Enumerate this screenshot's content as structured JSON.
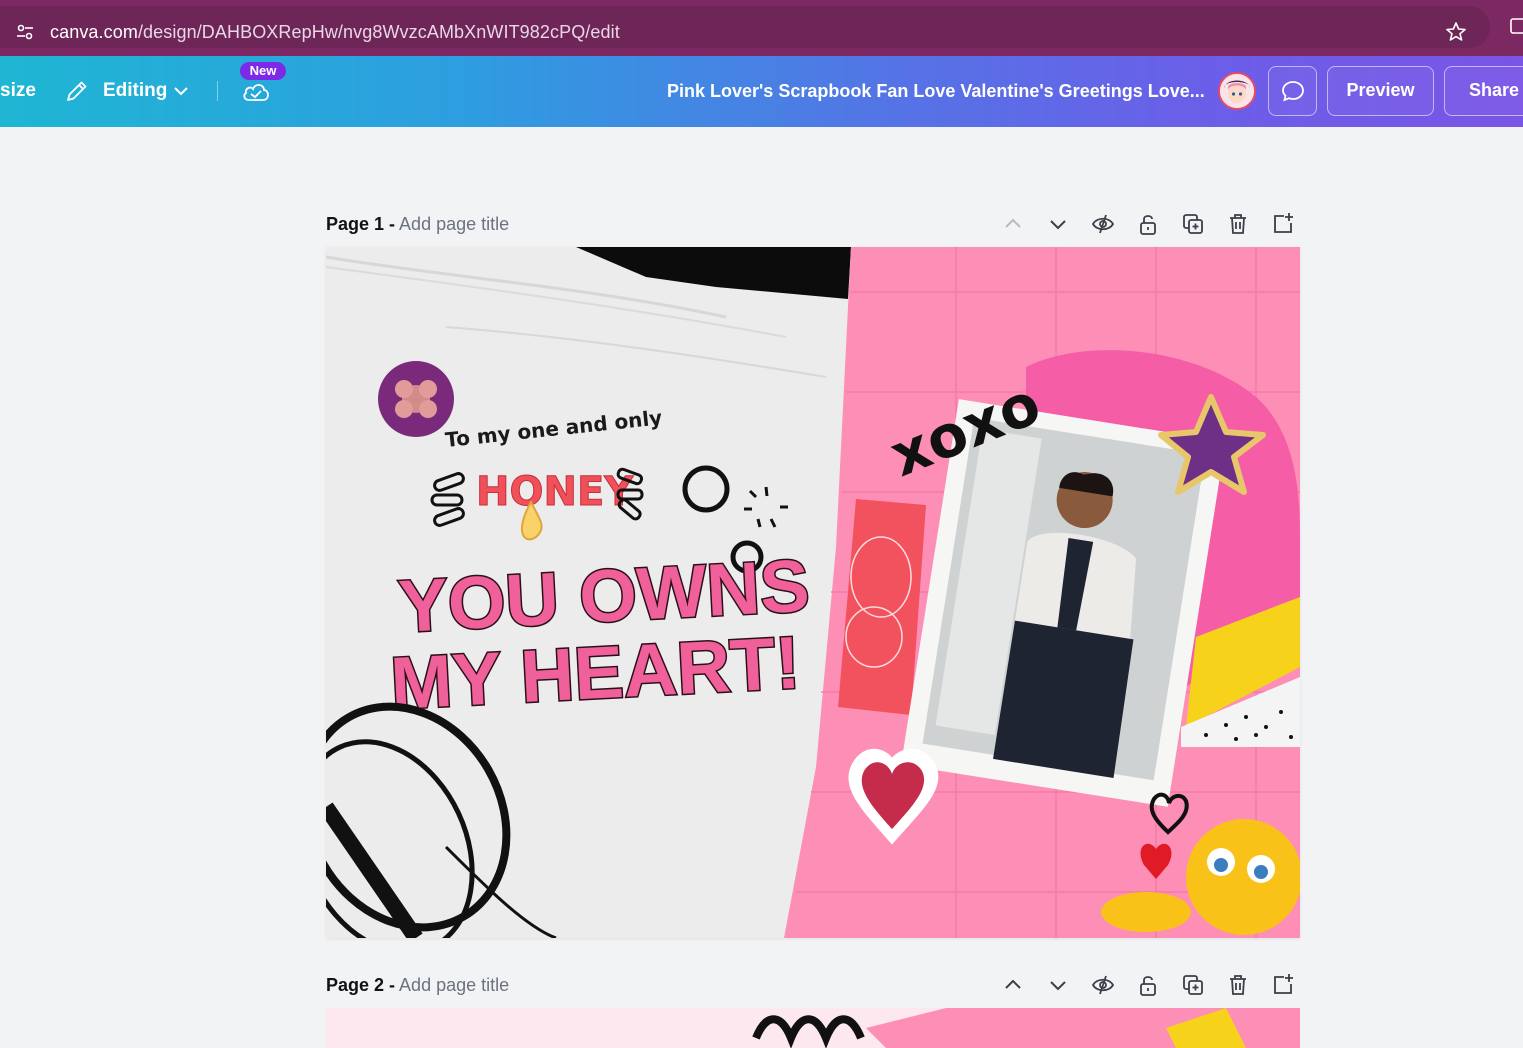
{
  "browser": {
    "url_host": "canva.com",
    "url_path": "/design/DAHBOXRepHw/nvg8WvzcAMbXnWIT982cPQ/edit"
  },
  "toolbar": {
    "resize_label": "size",
    "editing_label": "Editing",
    "new_badge": "New",
    "design_title": "Pink Lover's Scrapbook Fan Love Valentine's Greetings Love...",
    "preview_label": "Preview",
    "share_label": "Share"
  },
  "pages": [
    {
      "number_label": "Page 1 -",
      "title_placeholder": "Add page title"
    },
    {
      "number_label": "Page 2 -",
      "title_placeholder": "Add page title"
    }
  ],
  "design": {
    "greeting_line": "To my one and only",
    "honey_word": "HONEY",
    "headline_line1": "YOU OWNS",
    "headline_line2": "MY HEART!",
    "xoxo": "xoxo"
  },
  "colors": {
    "browser_bar": "#7b2863",
    "accent_pink": "#ff8fb3",
    "headline_pink": "#f0609a"
  },
  "icons": [
    "site-settings-icon",
    "star-icon",
    "extensions-icon",
    "pencil-icon",
    "chevron-down-icon",
    "cloud-check-icon",
    "comment-icon",
    "chevron-up-icon",
    "hide-icon",
    "lock-icon",
    "duplicate-icon",
    "trash-icon",
    "add-page-icon"
  ]
}
